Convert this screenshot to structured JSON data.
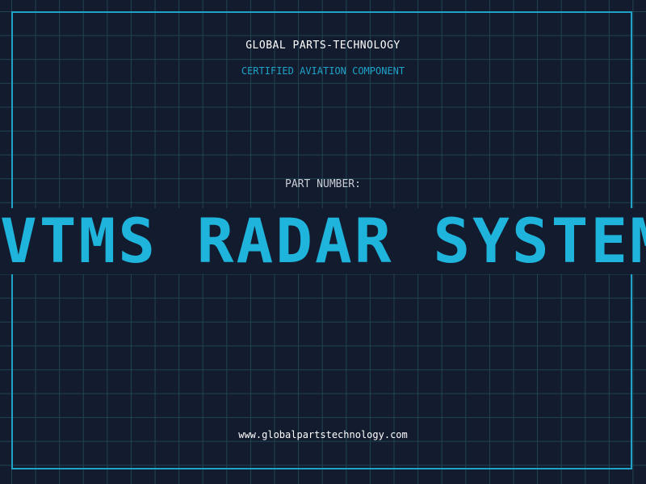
{
  "header": {
    "company": "GLOBAL PARTS-TECHNOLOGY",
    "tagline": "CERTIFIED AVIATION COMPONENT"
  },
  "main": {
    "part_number_label": "PART NUMBER:",
    "part_name": "VTMS RADAR SYSTEM"
  },
  "footer": {
    "website": "www.globalpartstechnology.com"
  },
  "colors": {
    "background": "#131b2e",
    "grid": "#1f4452",
    "accent": "#1fb4dc",
    "frame": "#1fa3c8",
    "text": "#ffffff"
  }
}
